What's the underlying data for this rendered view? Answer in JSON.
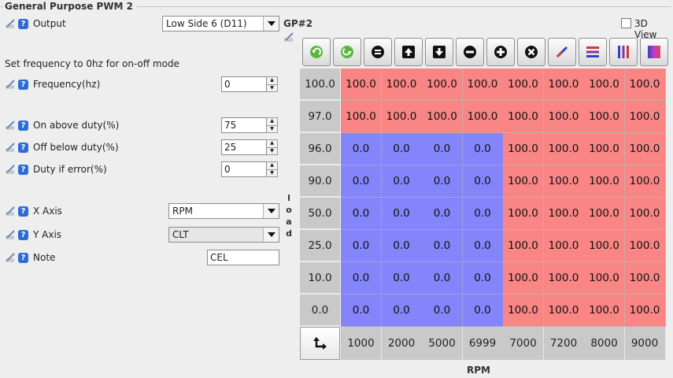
{
  "panel": {
    "title": "General Purpose PWM 2"
  },
  "output": {
    "label": "Output",
    "value": "Low Side 6 (D11)",
    "tag": "GP#2"
  },
  "view3d": {
    "label": "3D View",
    "checked": false
  },
  "hint": "Set frequency to 0hz for on-off mode",
  "fields": {
    "frequency": {
      "label": "Frequency(hz)",
      "value": "0"
    },
    "on_above": {
      "label": "On above duty(%)",
      "value": "75"
    },
    "off_below": {
      "label": "Off below duty(%)",
      "value": "25"
    },
    "duty_error": {
      "label": "Duty if error(%)",
      "value": "0"
    }
  },
  "axes": {
    "x": {
      "label": "X Axis",
      "value": "RPM"
    },
    "y": {
      "label": "Y Axis",
      "value": "CLT"
    }
  },
  "note": {
    "label": "Note",
    "value": "CEL"
  },
  "toolbar": [
    {
      "name": "undo-button",
      "icon": "green-back-arrow-icon"
    },
    {
      "name": "redo-button",
      "icon": "green-down-arrow-icon"
    },
    {
      "name": "set-equal-button",
      "icon": "equals-icon"
    },
    {
      "name": "increase-button",
      "icon": "up-arrow-icon"
    },
    {
      "name": "decrease-button",
      "icon": "down-arrow-icon"
    },
    {
      "name": "subtract-button",
      "icon": "minus-icon"
    },
    {
      "name": "add-button",
      "icon": "plus-icon"
    },
    {
      "name": "multiply-button",
      "icon": "times-icon"
    },
    {
      "name": "interpolate-button",
      "icon": "pen-icon"
    },
    {
      "name": "interpolate-rows-button",
      "icon": "horizontal-bars-icon"
    },
    {
      "name": "interpolate-cols-button",
      "icon": "vertical-bars-icon"
    },
    {
      "name": "gradient-button",
      "icon": "gradient-icon"
    }
  ],
  "table": {
    "y_axis_name": "load",
    "x_axis_name": "RPM",
    "y_values": [
      "100.0",
      "97.0",
      "96.0",
      "90.0",
      "50.0",
      "25.0",
      "10.0",
      "0.0"
    ],
    "x_values": [
      "1000",
      "2000",
      "5000",
      "6999",
      "7000",
      "7200",
      "8000",
      "9000"
    ],
    "cells": [
      [
        "100.0",
        "100.0",
        "100.0",
        "100.0",
        "100.0",
        "100.0",
        "100.0",
        "100.0"
      ],
      [
        "100.0",
        "100.0",
        "100.0",
        "100.0",
        "100.0",
        "100.0",
        "100.0",
        "100.0"
      ],
      [
        "0.0",
        "0.0",
        "0.0",
        "0.0",
        "100.0",
        "100.0",
        "100.0",
        "100.0"
      ],
      [
        "0.0",
        "0.0",
        "0.0",
        "0.0",
        "100.0",
        "100.0",
        "100.0",
        "100.0"
      ],
      [
        "0.0",
        "0.0",
        "0.0",
        "0.0",
        "100.0",
        "100.0",
        "100.0",
        "100.0"
      ],
      [
        "0.0",
        "0.0",
        "0.0",
        "0.0",
        "100.0",
        "100.0",
        "100.0",
        "100.0"
      ],
      [
        "0.0",
        "0.0",
        "0.0",
        "0.0",
        "100.0",
        "100.0",
        "100.0",
        "100.0"
      ],
      [
        "0.0",
        "0.0",
        "0.0",
        "0.0",
        "100.0",
        "100.0",
        "100.0",
        "100.0"
      ]
    ],
    "colors": {
      "high": "#f98684",
      "low": "#8585fb",
      "axis": "#c9c9c9"
    }
  }
}
